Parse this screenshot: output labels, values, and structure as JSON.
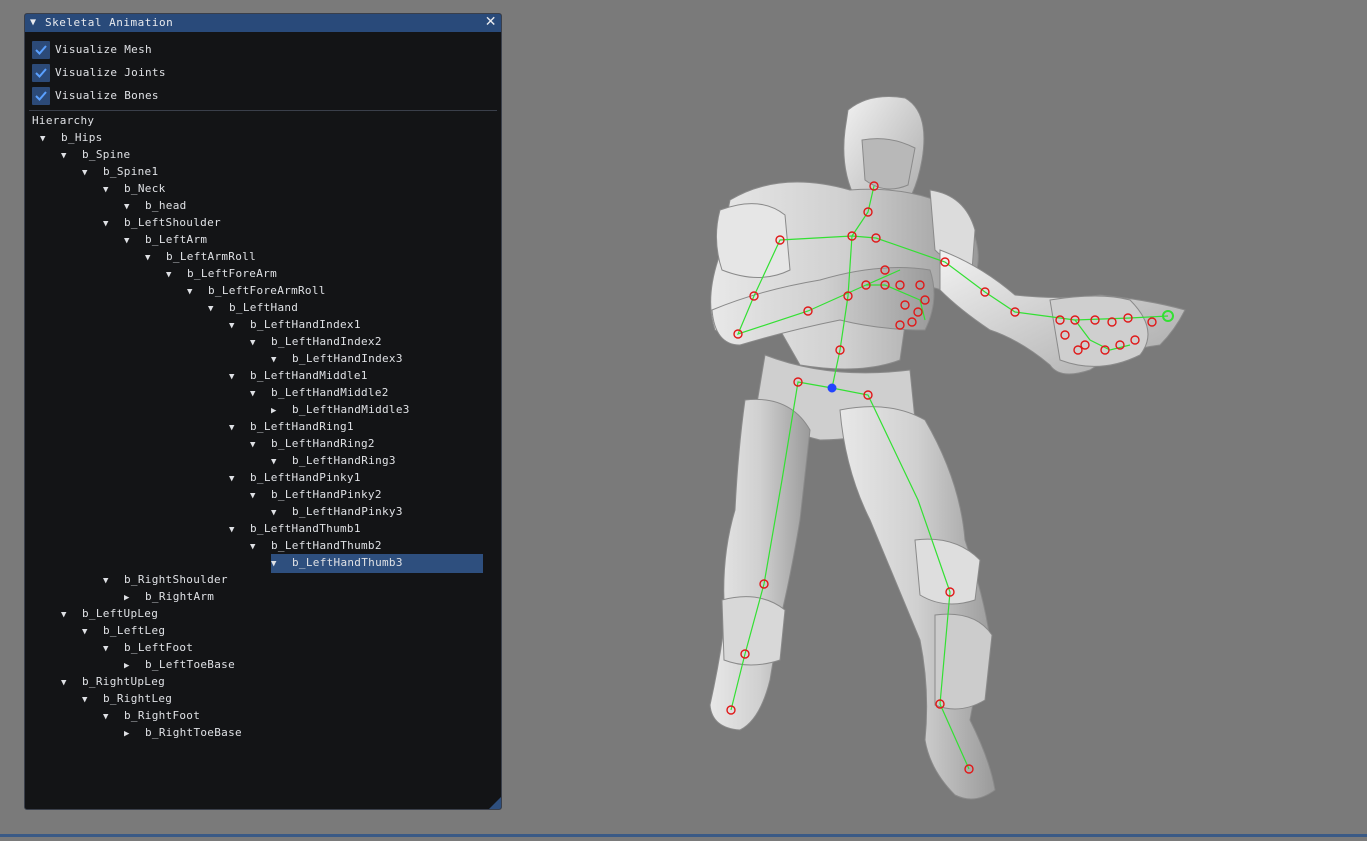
{
  "window": {
    "title": "Skeletal Animation",
    "close_symbol": "✕"
  },
  "options": [
    {
      "label": "Visualize Mesh",
      "checked": true
    },
    {
      "label": "Visualize Joints",
      "checked": true
    },
    {
      "label": "Visualize Bones",
      "checked": true
    }
  ],
  "hierarchy": {
    "heading": "Hierarchy",
    "nodes": [
      {
        "label": "b_Hips",
        "depth": 0,
        "expanded": true
      },
      {
        "label": "b_Spine",
        "depth": 1,
        "expanded": true
      },
      {
        "label": "b_Spine1",
        "depth": 2,
        "expanded": true
      },
      {
        "label": "b_Neck",
        "depth": 3,
        "expanded": true
      },
      {
        "label": "b_head",
        "depth": 4,
        "expanded": true
      },
      {
        "label": "b_LeftShoulder",
        "depth": 3,
        "expanded": true
      },
      {
        "label": "b_LeftArm",
        "depth": 4,
        "expanded": true
      },
      {
        "label": "b_LeftArmRoll",
        "depth": 5,
        "expanded": true
      },
      {
        "label": "b_LeftForeArm",
        "depth": 6,
        "expanded": true
      },
      {
        "label": "b_LeftForeArmRoll",
        "depth": 7,
        "expanded": true
      },
      {
        "label": "b_LeftHand",
        "depth": 8,
        "expanded": true
      },
      {
        "label": "b_LeftHandIndex1",
        "depth": 9,
        "expanded": true
      },
      {
        "label": "b_LeftHandIndex2",
        "depth": 10,
        "expanded": true
      },
      {
        "label": "b_LeftHandIndex3",
        "depth": 11,
        "expanded": true
      },
      {
        "label": "b_LeftHandMiddle1",
        "depth": 9,
        "expanded": true
      },
      {
        "label": "b_LeftHandMiddle2",
        "depth": 10,
        "expanded": true
      },
      {
        "label": "b_LeftHandMiddle3",
        "depth": 11,
        "expanded": false
      },
      {
        "label": "b_LeftHandRing1",
        "depth": 9,
        "expanded": true
      },
      {
        "label": "b_LeftHandRing2",
        "depth": 10,
        "expanded": true
      },
      {
        "label": "b_LeftHandRing3",
        "depth": 11,
        "expanded": true
      },
      {
        "label": "b_LeftHandPinky1",
        "depth": 9,
        "expanded": true
      },
      {
        "label": "b_LeftHandPinky2",
        "depth": 10,
        "expanded": true
      },
      {
        "label": "b_LeftHandPinky3",
        "depth": 11,
        "expanded": true
      },
      {
        "label": "b_LeftHandThumb1",
        "depth": 9,
        "expanded": true
      },
      {
        "label": "b_LeftHandThumb2",
        "depth": 10,
        "expanded": true
      },
      {
        "label": "b_LeftHandThumb3",
        "depth": 11,
        "expanded": true,
        "selected": true
      },
      {
        "label": "b_RightShoulder",
        "depth": 3,
        "expanded": true
      },
      {
        "label": "b_RightArm",
        "depth": 4,
        "expanded": false
      },
      {
        "label": "b_LeftUpLeg",
        "depth": 1,
        "expanded": true
      },
      {
        "label": "b_LeftLeg",
        "depth": 2,
        "expanded": true
      },
      {
        "label": "b_LeftFoot",
        "depth": 3,
        "expanded": true
      },
      {
        "label": "b_LeftToeBase",
        "depth": 4,
        "expanded": false
      },
      {
        "label": "b_RightUpLeg",
        "depth": 1,
        "expanded": true
      },
      {
        "label": "b_RightLeg",
        "depth": 2,
        "expanded": true
      },
      {
        "label": "b_RightFoot",
        "depth": 3,
        "expanded": true
      },
      {
        "label": "b_RightToeBase",
        "depth": 4,
        "expanded": false
      }
    ]
  },
  "colors": {
    "background": "#7a7a7a",
    "panel": "#131416",
    "title_bar": "#294a7a",
    "checkbox": "#2c4a78",
    "selection": "#2e4f7e",
    "bone": "#33e033",
    "joint": "#e01818",
    "root_joint": "#2244ff"
  }
}
